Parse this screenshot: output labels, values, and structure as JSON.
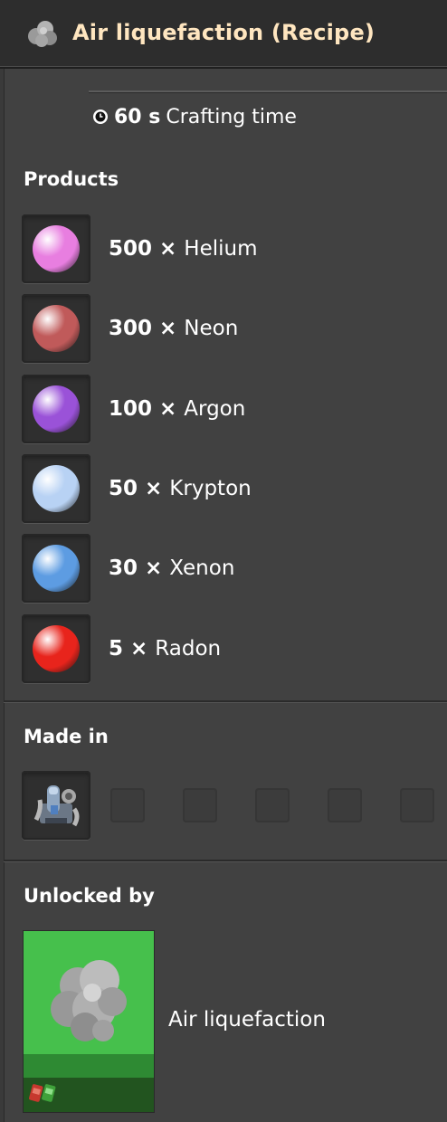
{
  "header": {
    "title": "Air liquefaction (Recipe)",
    "icon": "cloud-icon"
  },
  "crafting": {
    "time": "60 s",
    "label": "Crafting time",
    "icon": "clock-icon"
  },
  "products": {
    "title": "Products",
    "items": [
      {
        "amount": "500",
        "times": "×",
        "name": "Helium",
        "color": "#e87ee0"
      },
      {
        "amount": "300",
        "times": "×",
        "name": "Neon",
        "color": "#c05a5a"
      },
      {
        "amount": "100",
        "times": "×",
        "name": "Argon",
        "color": "#9a52d8"
      },
      {
        "amount": "50",
        "times": "×",
        "name": "Krypton",
        "color": "#b8d2f4"
      },
      {
        "amount": "30",
        "times": "×",
        "name": "Xenon",
        "color": "#5d9ce2"
      },
      {
        "amount": "5",
        "times": "×",
        "name": "Radon",
        "color": "#e8241c"
      }
    ]
  },
  "made_in": {
    "title": "Made in",
    "machine_icon": "chemical-plant-icon",
    "empty_slots": 5
  },
  "unlocked_by": {
    "title": "Unlocked by",
    "tech_name": "Air liquefaction",
    "tech_icon": "air-cloud-icon",
    "card_color": "#46c04c",
    "science_packs": [
      "red-science-pack-icon",
      "green-science-pack-icon"
    ]
  }
}
